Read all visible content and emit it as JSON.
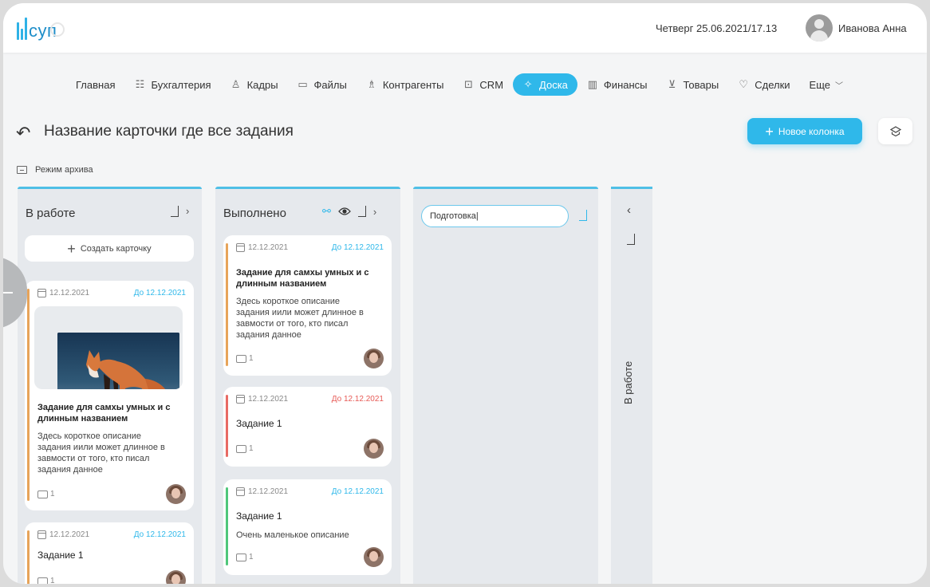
{
  "header": {
    "logo_text": "суп",
    "datetime": "Четверг 25.06.2021/17.13",
    "username": "Иванова Анна"
  },
  "nav": [
    {
      "label": "Главная",
      "icon": "home-icon",
      "glyph": ""
    },
    {
      "label": "Бухгалтерия",
      "icon": "ledger-icon",
      "glyph": "☷"
    },
    {
      "label": "Кадры",
      "icon": "person-icon",
      "glyph": "♙"
    },
    {
      "label": "Файлы",
      "icon": "folder-icon",
      "glyph": "▭"
    },
    {
      "label": "Контрагенты",
      "icon": "contractor-icon",
      "glyph": "♗"
    },
    {
      "label": "CRM",
      "icon": "crm-icon",
      "glyph": "⊡"
    },
    {
      "label": "Доска",
      "icon": "pin-icon",
      "glyph": "✧",
      "active": true
    },
    {
      "label": "Финансы",
      "icon": "chart-icon",
      "glyph": "▥"
    },
    {
      "label": "Товары",
      "icon": "cart-icon",
      "glyph": "⊻"
    },
    {
      "label": "Сделки",
      "icon": "handshake-icon",
      "glyph": "♡"
    },
    {
      "label": "Еще",
      "icon": "chevron-down-icon",
      "glyph": ""
    }
  ],
  "page": {
    "title": "Название карточки где все задания",
    "new_column_label": "Новое колонка",
    "archive_label": "Режим архива"
  },
  "columns": [
    {
      "title": "В работе",
      "create_label": "Создать карточку",
      "cards": [
        {
          "date": "12.12.2021",
          "due": "До 12.12.2021",
          "title_l1": "Задание для самхы умных и с",
          "title_l2": "длинным названием",
          "desc_l1": "Здесь короткое описание",
          "desc_l2": "задания иили может длинное в",
          "desc_l3": "завмости от того, кто писал",
          "desc_l4": "задания данное",
          "comments": "1",
          "stripe": "#e7a45a"
        },
        {
          "date": "12.12.2021",
          "due": "До 12.12.2021",
          "title_l1": "Задание 1",
          "comments": "1",
          "stripe": "#e7a45a"
        }
      ]
    },
    {
      "title": "Выполнено",
      "cards": [
        {
          "date": "12.12.2021",
          "due": "До 12.12.2021",
          "title_l1": "Задание для самхы умных и с",
          "title_l2": "длинным названием",
          "desc_l1": "Здесь короткое описание",
          "desc_l2": "задания иили может длинное в",
          "desc_l3": "завмости от того, кто писал",
          "desc_l4": "задания данное",
          "comments": "1",
          "stripe": "#e7a45a"
        },
        {
          "date": "12.12.2021",
          "due": "До 12.12.2021",
          "title_l1": "Задание 1",
          "comments": "1",
          "stripe": "#e86a64",
          "due_color": "#e75a56"
        },
        {
          "date": "12.12.2021",
          "due": "До 12.12.2021",
          "title_l1": "Задание 1",
          "desc_l1": "Очень маленькое описание",
          "comments": "1",
          "stripe": "#4fc77a"
        }
      ]
    },
    {
      "input_value": "Подготовка|"
    },
    {
      "title": "В работе",
      "collapsed": true
    }
  ],
  "colors": {
    "accent": "#2fb8ea",
    "column_bg": "#e6e9ed"
  }
}
